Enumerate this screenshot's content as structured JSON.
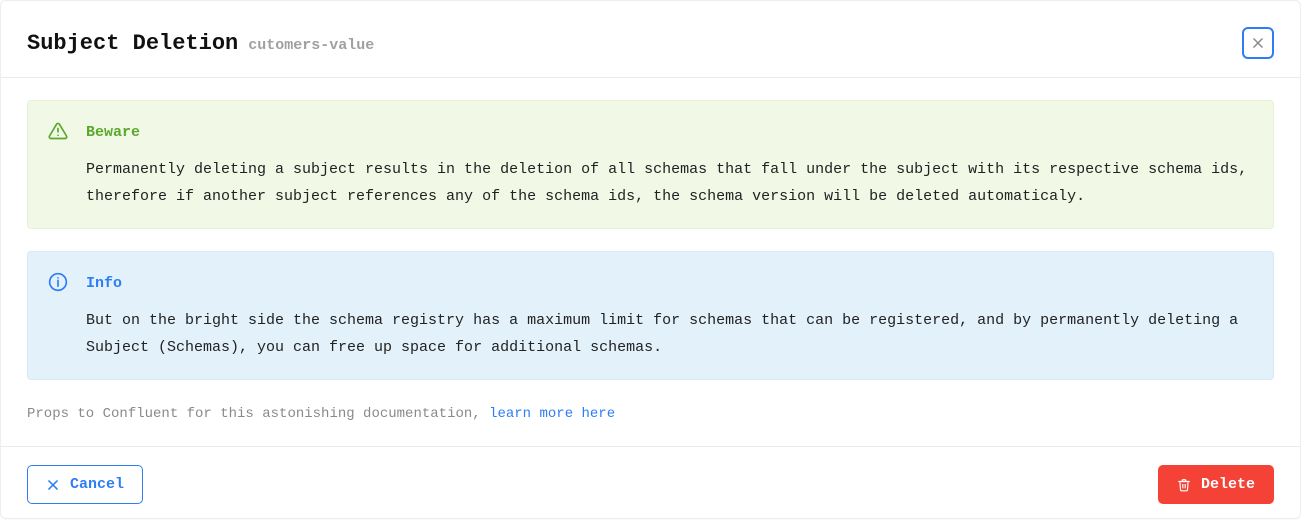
{
  "header": {
    "title": "Subject Deletion",
    "subject": "cutomers-value"
  },
  "alerts": {
    "beware": {
      "title": "Beware",
      "body": "Permanently deleting a subject results in the deletion of all schemas that fall under the subject with its respective schema ids, therefore if another subject references any of the schema ids, the schema version will be deleted automaticaly."
    },
    "info": {
      "title": "Info",
      "body": "But on the bright side the schema registry has a maximum limit for schemas that can be registered, and by permanently deleting a Subject (Schemas), you can free up space for additional schemas."
    }
  },
  "docs": {
    "prefix": "Props to Confluent for this astonishing documentation, ",
    "link_text": "learn more here"
  },
  "footer": {
    "cancel": "Cancel",
    "delete": "Delete"
  }
}
